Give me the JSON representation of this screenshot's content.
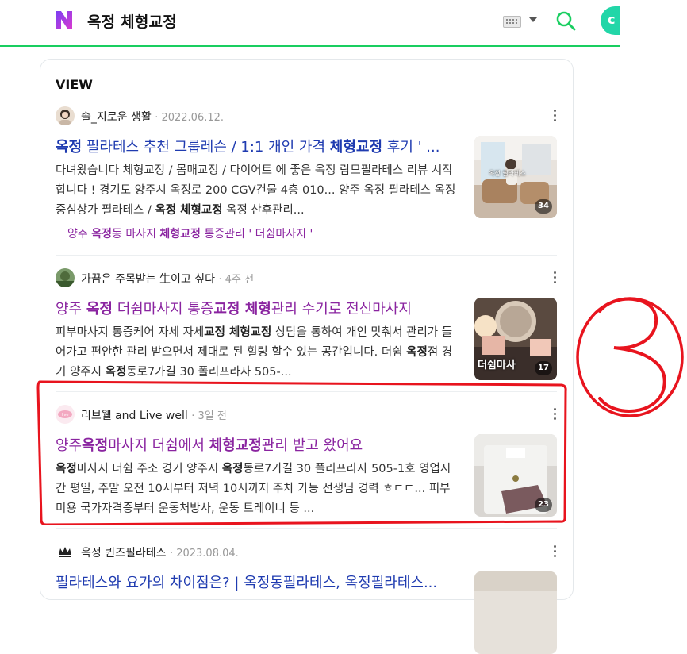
{
  "header": {
    "logo_letter": "N",
    "query": "옥정 체형교정",
    "green": "#19ce60"
  },
  "section": {
    "title": "VIEW"
  },
  "items": [
    {
      "author": "솔_지로운 생활",
      "date": "2022.06.12.",
      "title_parts": [
        {
          "t": "옥정",
          "b": true
        },
        {
          "t": " 필라테스 추천 그룹레슨 / 1:1 개인 가격 ",
          "b": false
        },
        {
          "t": "체형교정",
          "b": true
        },
        {
          "t": " 후기 ' ...",
          "b": false
        }
      ],
      "title_color": "blue",
      "desc_parts": [
        {
          "t": "다녀왔습니다 체형교정 / 몸매교정 / 다이어트 에 좋은 옥정 람므필라테스 리뷰 시작합니다 ! 경기도 양주시 옥정로 200 CGV건물 4층 010... 양주 옥정 필라테스 옥정 중심상가 필라테스 / ",
          "b": false
        },
        {
          "t": "옥정 체형교정",
          "b": true
        },
        {
          "t": " 옥정 산후관리...",
          "b": false
        }
      ],
      "related_parts": [
        {
          "t": "양주 ",
          "b": false
        },
        {
          "t": "옥정",
          "b": true
        },
        {
          "t": "동 마사지 ",
          "b": false
        },
        {
          "t": "체형교정",
          "b": true
        },
        {
          "t": " 통증관리 ' 더쉼마사지 '",
          "b": false
        }
      ],
      "thumb_count": "34",
      "thumb_caption": "옥정 필라테스"
    },
    {
      "author": "가끔은 주목받는 生이고 싶다",
      "date": "4주 전",
      "title_parts": [
        {
          "t": "양주 ",
          "b": false
        },
        {
          "t": "옥정",
          "b": true
        },
        {
          "t": " 더쉼마사지 통증",
          "b": false
        },
        {
          "t": "교정 체형",
          "b": true
        },
        {
          "t": "관리 수기로 전신마사지",
          "b": false
        }
      ],
      "title_color": "purple",
      "desc_parts": [
        {
          "t": "피부마사지 통증케어 자세 자세",
          "b": false
        },
        {
          "t": "교정 체형교정",
          "b": true
        },
        {
          "t": " 상담을 통하여 개인 맞춰서 관리가 들어가고 편안한 관리 받으면서 제대로 된 힐링 할수 있는 공간입니다. 더쉼 ",
          "b": false
        },
        {
          "t": "옥정",
          "b": true
        },
        {
          "t": "점 경기 양주시 ",
          "b": false
        },
        {
          "t": "옥정",
          "b": true
        },
        {
          "t": "동로7가길 30 폴리프라자 505-...",
          "b": false
        }
      ],
      "thumb_count": "17",
      "thumb_caption": "더쉼마사"
    },
    {
      "author": "리브웰 and Live well",
      "date": "3일 전",
      "title_parts": [
        {
          "t": "양주",
          "b": false
        },
        {
          "t": "옥정",
          "b": true
        },
        {
          "t": "마사지 더쉼에서 ",
          "b": false
        },
        {
          "t": "체형교정",
          "b": true
        },
        {
          "t": "관리 받고 왔어요",
          "b": false
        }
      ],
      "title_color": "purple",
      "desc_parts": [
        {
          "t": "옥정",
          "b": true
        },
        {
          "t": "마사지 더쉼 주소 경기 양주시 ",
          "b": false
        },
        {
          "t": "옥정",
          "b": true
        },
        {
          "t": "동로7가길 30 폴리프라자 505-1호 영업시간 평일, 주말 오전 10시부터 저녁 10시까지 주차 가능 선생님 경력 ㅎㄷㄷ... 피부미용 국가자격증부터 운동처방사, 운동 트레이너 등 ...",
          "b": false
        }
      ],
      "thumb_count": "23"
    },
    {
      "author": "옥정 퀸즈필라테스",
      "date": "2023.08.04.",
      "title_parts": [
        {
          "t": "필라테스와 요가의 차이점은? | 옥정동필라테스, 옥정필라테스...",
          "b": false
        }
      ],
      "title_color": "blue"
    }
  ],
  "annotation": {
    "label": "3",
    "color": "#e8141e"
  }
}
